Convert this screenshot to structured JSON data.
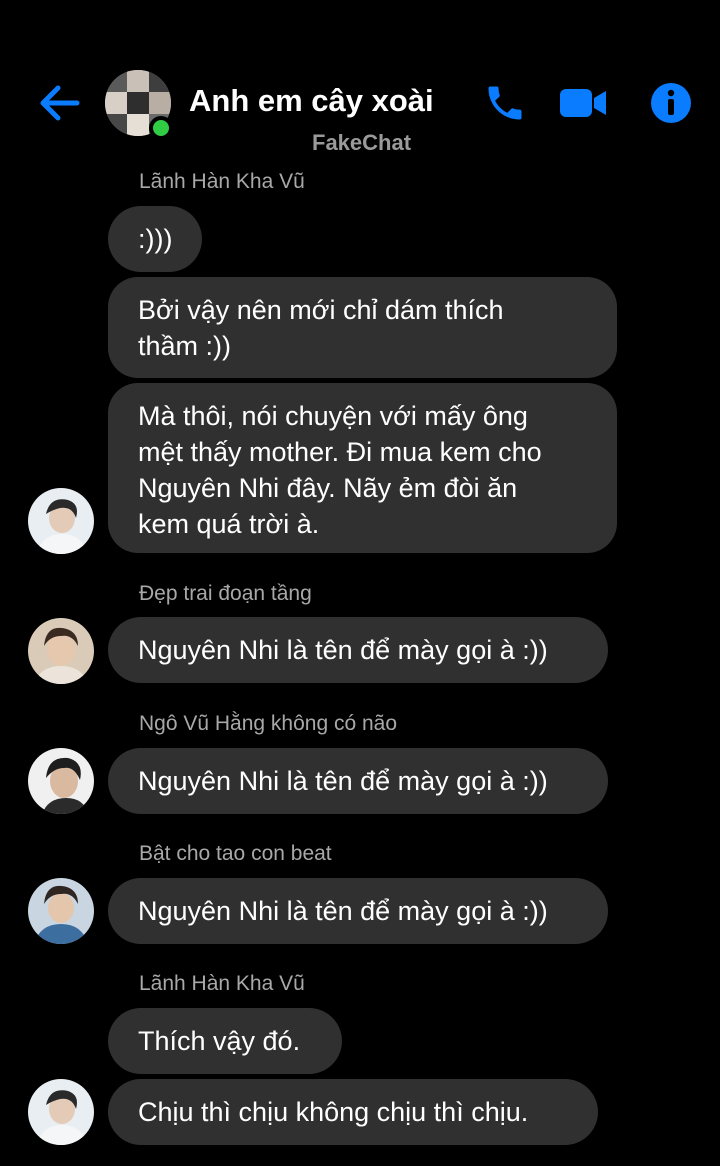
{
  "header": {
    "title": "Anh em cây xoài",
    "subtitle": "FakeChat",
    "accent_color": "#0a7cff",
    "online_color": "#31cc46",
    "icons": [
      "back-arrow-icon",
      "group-avatar",
      "phone-icon",
      "video-camera-icon",
      "info-icon"
    ]
  },
  "messages": [
    {
      "sender": "Lãnh Hàn Kha Vũ",
      "bubbles": [
        {
          "lines": [
            ":)))"
          ]
        },
        {
          "lines": [
            "Bởi vậy nên mới chỉ dám thích",
            "thầm :))"
          ]
        },
        {
          "lines": [
            "Mà thôi, nói chuyện với mấy ông",
            "mệt thấy mother. Đi mua kem cho",
            "Nguyên Nhi đây. Nãy ẻm đòi ăn",
            "kem quá trời à."
          ]
        }
      ]
    },
    {
      "sender": "Đẹp trai đoạn tầng",
      "bubbles": [
        {
          "lines": [
            "Nguyên Nhi là tên để mày gọi à :))"
          ]
        }
      ]
    },
    {
      "sender": "Ngô Vũ Hằng không có não",
      "bubbles": [
        {
          "lines": [
            "Nguyên Nhi là tên để mày gọi à :))"
          ]
        }
      ]
    },
    {
      "sender": "Bật cho tao con beat",
      "bubbles": [
        {
          "lines": [
            "Nguyên Nhi là tên để mày gọi à :))"
          ]
        }
      ]
    },
    {
      "sender": "Lãnh Hàn Kha Vũ",
      "bubbles": [
        {
          "lines": [
            "Thích vậy đó."
          ]
        },
        {
          "lines": [
            "Chịu thì chịu không chịu thì chịu."
          ]
        }
      ]
    }
  ],
  "colors": {
    "background": "#000000",
    "bubble": "#303030",
    "sender_text": "#a8a8a8"
  }
}
